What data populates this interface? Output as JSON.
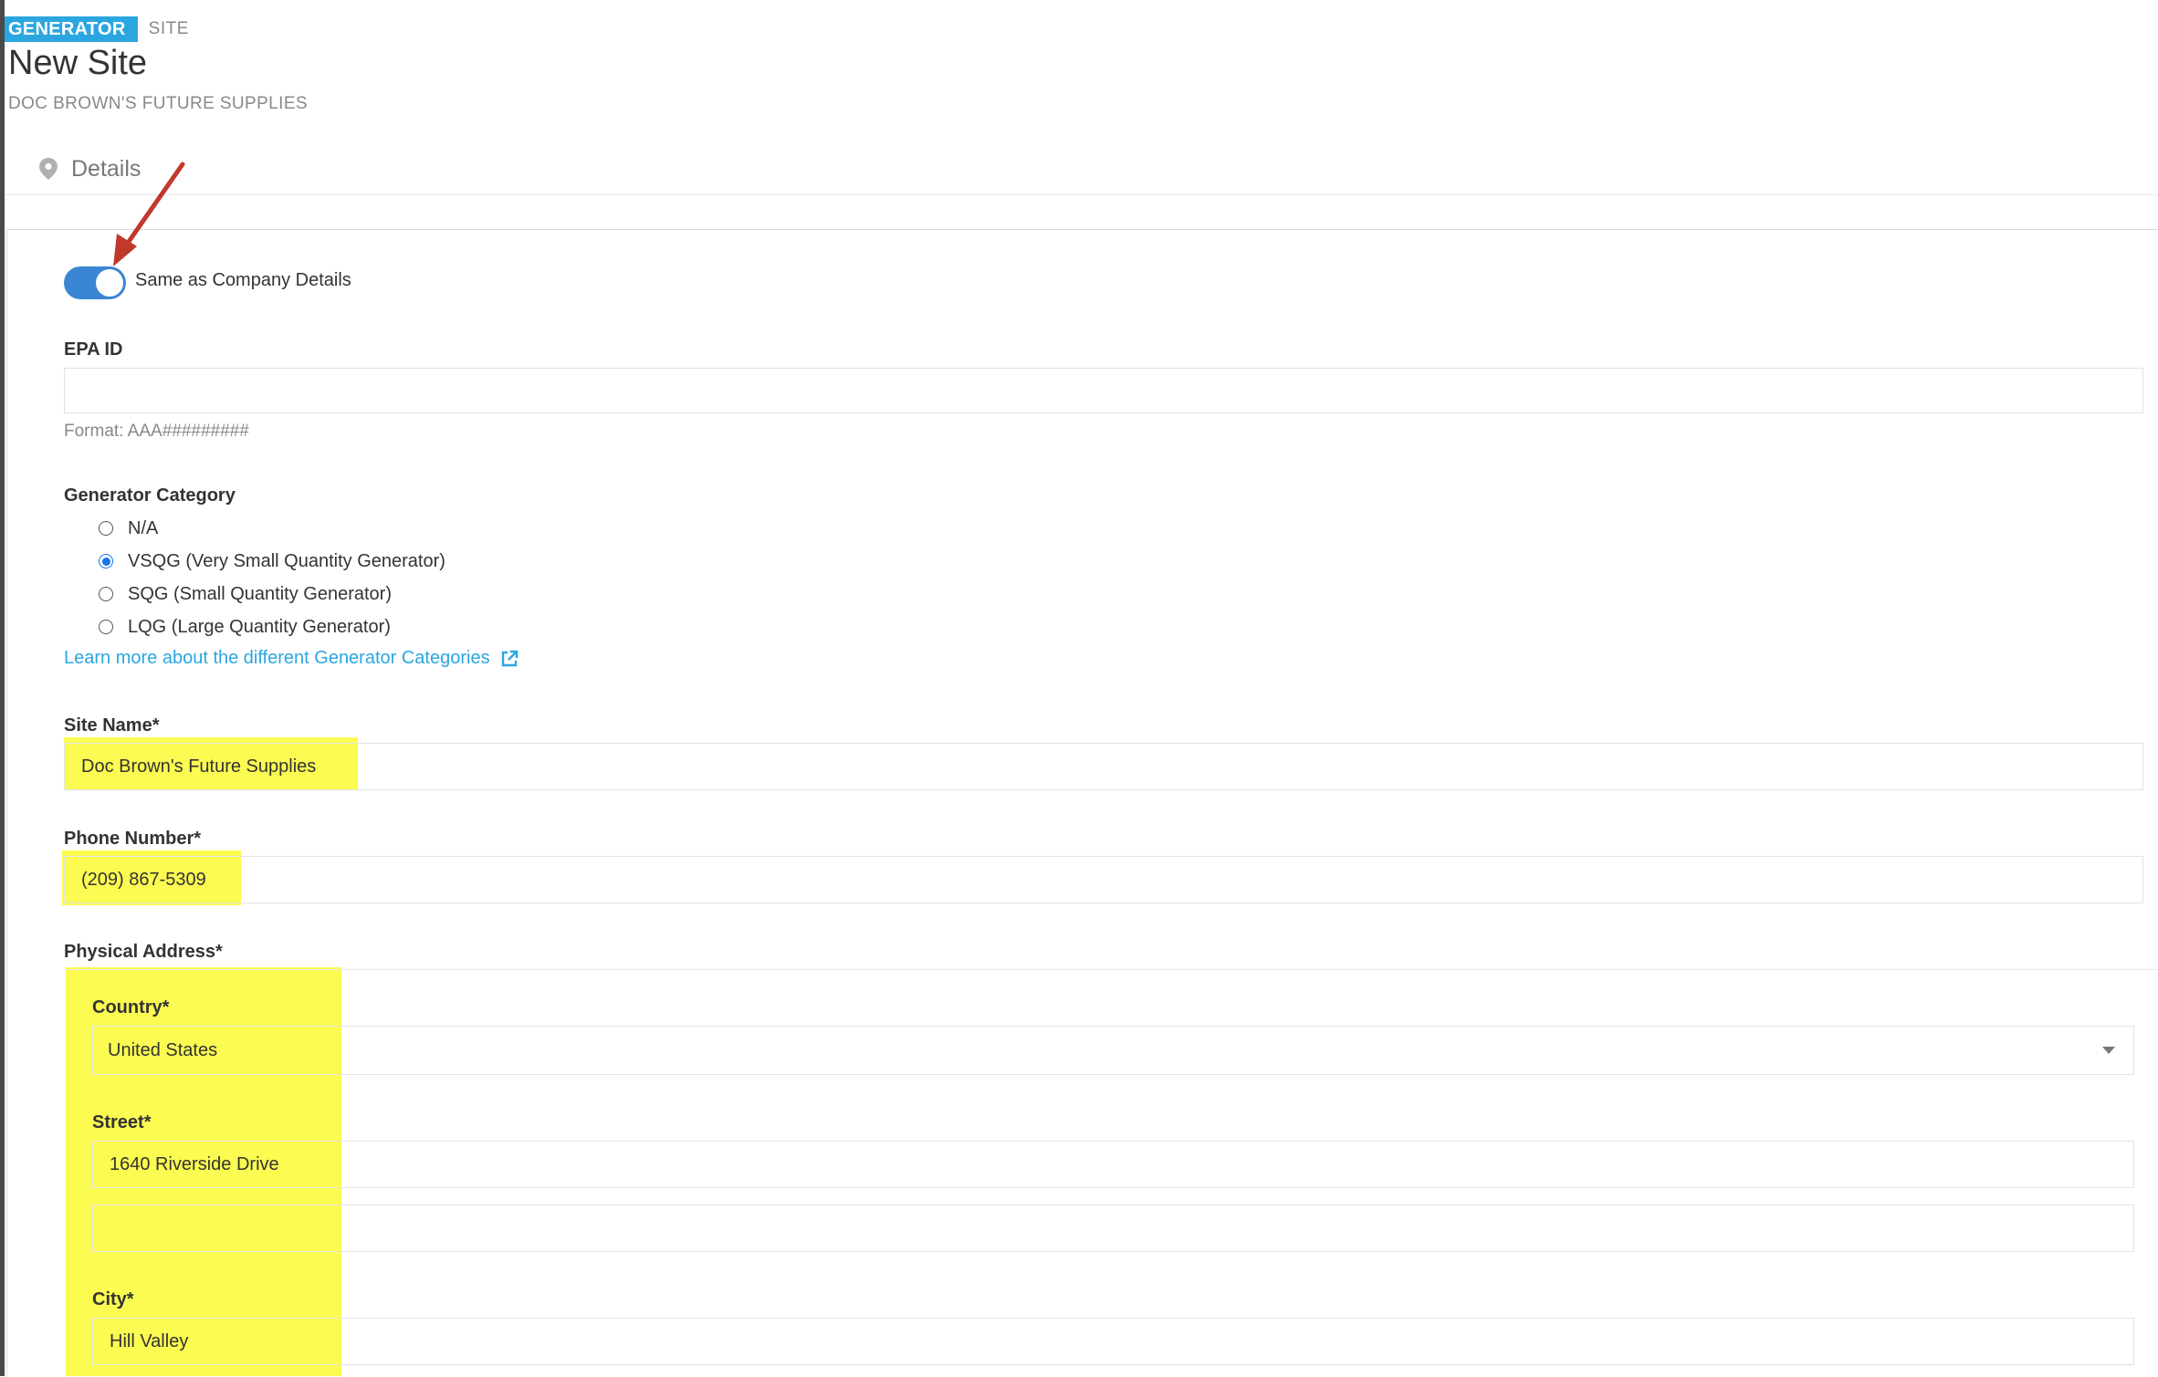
{
  "breadcrumb": {
    "active": "GENERATOR",
    "current": "SITE"
  },
  "page": {
    "title": "New Site",
    "subtitle": "DOC BROWN'S FUTURE SUPPLIES"
  },
  "tabs": [
    {
      "label": "Details",
      "icon": "map-pin-icon"
    }
  ],
  "toggle": {
    "label": "Same as Company Details",
    "checked": true
  },
  "epa": {
    "label": "EPA ID",
    "value": "",
    "help": "Format: AAA#########"
  },
  "generator_category": {
    "label": "Generator Category",
    "options": [
      {
        "label": "N/A",
        "checked": false
      },
      {
        "label": "VSQG (Very Small Quantity Generator)",
        "checked": true
      },
      {
        "label": "SQG (Small Quantity Generator)",
        "checked": false
      },
      {
        "label": "LQG (Large Quantity Generator)",
        "checked": false
      }
    ],
    "learn_more": "Learn more about the different Generator Categories"
  },
  "site_name": {
    "label": "Site Name*",
    "value": "Doc Brown's Future Supplies"
  },
  "phone": {
    "label": "Phone Number*",
    "value": "(209) 867-5309"
  },
  "address": {
    "label": "Physical Address*",
    "country": {
      "label": "Country*",
      "value": "United States"
    },
    "street": {
      "label": "Street*",
      "line1": "1640 Riverside Drive",
      "line2": ""
    },
    "city": {
      "label": "City*",
      "value": "Hill Valley"
    }
  },
  "colors": {
    "accent": "#2ba6e0",
    "toggle": "#3a86d4",
    "highlight": "#fbfb51",
    "annotation": "#c0392b"
  }
}
